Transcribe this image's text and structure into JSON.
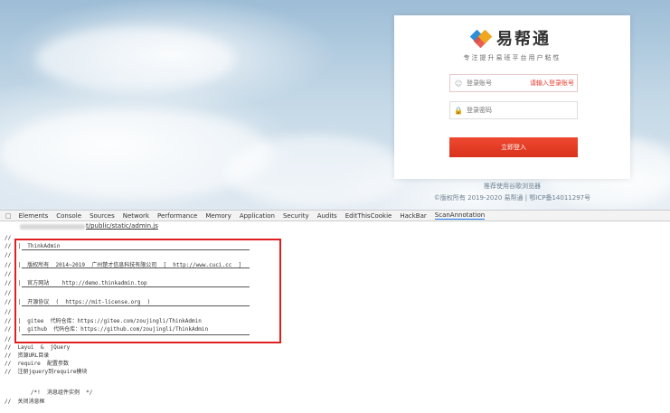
{
  "login": {
    "brand_name": "易帮通",
    "slogan": "专注提升易班平台用户粘性",
    "account_placeholder": "登录账号",
    "account_error": "请输入登录账号",
    "password_placeholder": "登录密码",
    "login_button": "立即登入",
    "tip": "推荐使用谷歌浏览器",
    "copyright": "©版权所有 2019-2020 易帮通 | 鄂ICP备14011297号"
  },
  "devtools": {
    "tabs": [
      "Elements",
      "Console",
      "Sources",
      "Network",
      "Performance",
      "Memory",
      "Application",
      "Security",
      "Audits",
      "EditThisCookie",
      "HackBar",
      "ScanAnnotation"
    ],
    "active_tab": "ScanAnnotation",
    "url": "t/public/static/admin.js",
    "code": {
      "l0": "//",
      "l1": "//  |  ThinkAdmin",
      "l2": "//",
      "l3": "//  |  版权所有  2014~2019  广州楚才信息科技有限公司  [  http://www.cuci.cc  ]",
      "l4": "//",
      "l5": "//  |  官方网站    http://demo.thinkadmin.top",
      "l6": "//",
      "l7": "//  |  开源协议  (  https://mit-license.org  )",
      "l8": "//",
      "l9": "//  |  gitee  代码仓库：https://gitee.com/zoujingli/ThinkAdmin",
      "l10": "//  |  github  代码仓库：https://github.com/zoujingli/ThinkAdmin",
      "l11": "//",
      "l12": "//  Layui  &  jQuery",
      "l13": "//  资源URL目录",
      "l14": "//  require  配置参数",
      "l15": "//  注册jquery到require模块",
      "l16": "",
      "l17": "        /*!  消息组件实例  */",
      "l18": "//  关闭消息框"
    }
  }
}
